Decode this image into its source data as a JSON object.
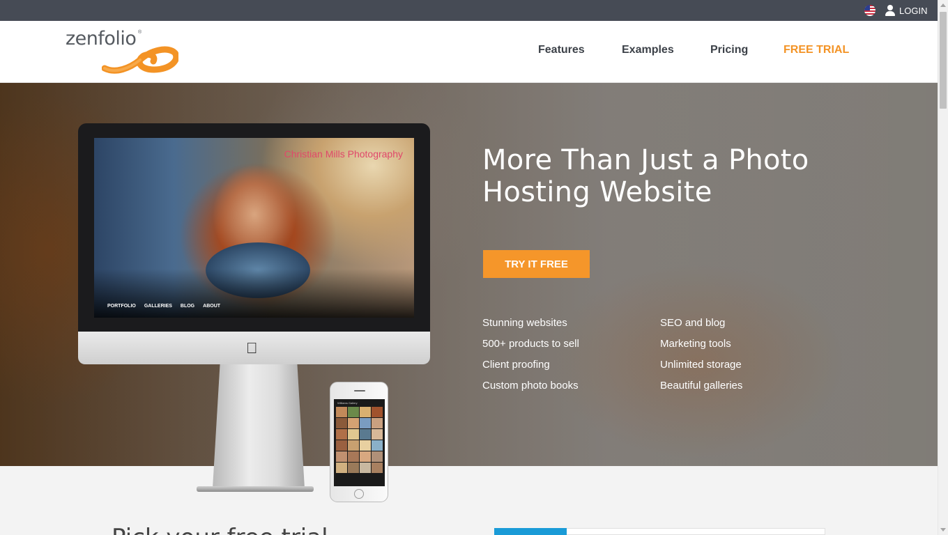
{
  "topbar": {
    "flag_icon": "us-flag-icon",
    "login_icon": "user-icon",
    "login_label": "LOGIN"
  },
  "header": {
    "logo_text": "zenfolio",
    "logo_mark": "®",
    "nav": [
      "Features",
      "Examples",
      "Pricing",
      "FREE TRIAL"
    ]
  },
  "hero": {
    "title_line1": "More Than Just a Photo",
    "title_line2": "Hosting Website",
    "cta_label": "TRY IT FREE",
    "features_left": [
      "Stunning websites",
      "500+ products to sell",
      "Client proofing",
      "Custom photo books"
    ],
    "features_right": [
      "SEO and blog",
      "Marketing tools",
      "Unlimited storage",
      "Beautiful galleries"
    ],
    "device_screen": {
      "site_title": "Christian Mills Photography",
      "site_nav": [
        "PORTFOLIO",
        "GALLERIES",
        "BLOG",
        "ABOUT"
      ],
      "phone_title": "Williams Gallery"
    }
  },
  "lower": {
    "heading_partial": "Pick your free trial"
  },
  "colors": {
    "accent": "#f39325",
    "cta": "#f5962a",
    "topbar": "#464b55",
    "nav_text": "#3c4148",
    "video_tab": "#1a9bd7"
  }
}
